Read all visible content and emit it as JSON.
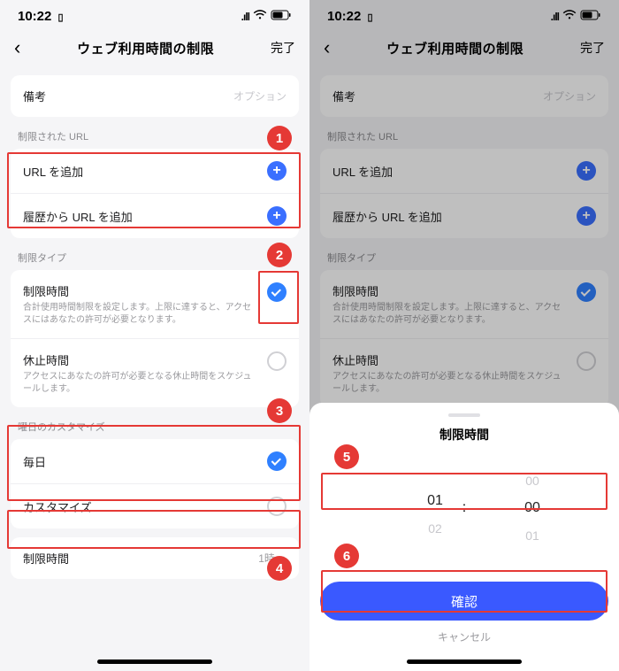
{
  "status": {
    "time": "10:22",
    "card": "▯",
    "signal": "𝗅𝗅𝐥𝐥",
    "wifi": "ᯤ",
    "battery": "▢"
  },
  "nav": {
    "back": "‹",
    "title": "ウェブ利用時間の制限",
    "done": "完了"
  },
  "memo": {
    "label": "備考",
    "placeholder": "オプション"
  },
  "urls": {
    "section": "制限された URL",
    "add": "URL を追加",
    "addFromHistory": "履歴から URL を追加"
  },
  "limitType": {
    "section": "制限タイプ",
    "limitTime": {
      "title": "制限時間",
      "sub": "合計使用時間制限を設定します。上限に達すると、アクセスにはあなたの許可が必要となります。"
    },
    "downtime": {
      "title": "休止時間",
      "sub": "アクセスにあなたの許可が必要となる休止時間をスケジュールします。"
    }
  },
  "days": {
    "section": "曜日のカスタマイズ",
    "everyday": "毎日",
    "custom": "カスタマイズ"
  },
  "limitRow": {
    "label": "制限時間",
    "value": "1時"
  },
  "sheet": {
    "title": "制限時間",
    "picker": {
      "h_prev": "",
      "h_cur": "01",
      "h_next": "02",
      "m_prev": "00",
      "m_cur": "00",
      "m_next": "01",
      "sep": ":"
    },
    "confirm": "確認",
    "cancel": "キャンセル"
  },
  "badges": {
    "1": "1",
    "2": "2",
    "3": "3",
    "4": "4",
    "5": "5",
    "6": "6"
  }
}
